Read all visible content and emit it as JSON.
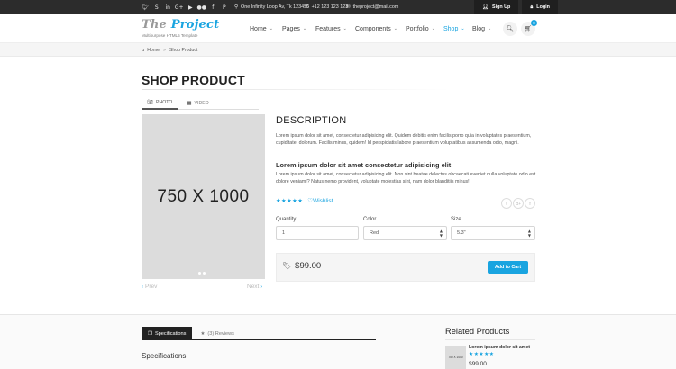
{
  "topbar": {
    "social_icons": [
      {
        "name": "twitter-icon",
        "glyph": "🐦︎"
      },
      {
        "name": "skype-icon",
        "glyph": "S"
      },
      {
        "name": "linkedin-icon",
        "glyph": "in"
      },
      {
        "name": "google-plus-icon",
        "glyph": "G+"
      },
      {
        "name": "youtube-icon",
        "glyph": "▶"
      },
      {
        "name": "flickr-icon",
        "glyph": "●●"
      },
      {
        "name": "facebook-icon",
        "glyph": "f"
      },
      {
        "name": "pinterest-icon",
        "glyph": "P"
      }
    ],
    "address": "One Infinity Loop Av, Tk 123456",
    "phone": "+12 123 123 123",
    "email": "theproject@mail.com",
    "signup_label": "Sign Up",
    "login_label": "Login"
  },
  "header": {
    "logo_the": "The",
    "logo_project": "Project",
    "tagline": "Multipurpose HTML5 Template",
    "nav": [
      {
        "label": "Home",
        "active": false
      },
      {
        "label": "Pages",
        "active": false
      },
      {
        "label": "Features",
        "active": false
      },
      {
        "label": "Components",
        "active": false
      },
      {
        "label": "Portfolio",
        "active": false
      },
      {
        "label": "Shop",
        "active": true
      },
      {
        "label": "Blog",
        "active": false
      }
    ],
    "cart_count": "0",
    "accent_color": "#19a4e0"
  },
  "breadcrumb": {
    "home": "Home",
    "current": "Shop Product"
  },
  "page": {
    "title": "SHOP PRODUCT"
  },
  "media": {
    "tab_photo": "PHOTO",
    "tab_video": "VIDEO",
    "placeholder": "750 X 1000",
    "prev": "Prev",
    "next": "Next"
  },
  "product": {
    "description_title": "DESCRIPTION",
    "para1": "Lorem ipsum dolor sit amet, consectetur adipisicing elit. Quidem debitis enim facilis porro quia in voluptates praesentium, cupiditate, dolorum. Facilis minus, quidem! Id perspiciatis labore praesentium voluptatibus assumenda odio, magni.",
    "subhead": "Lorem ipsum dolor sit amet consectetur adipisicing elit",
    "para2": "Lorem ipsum dolor sit amet, consectetur adipisicing elit. Non sint beatae delectus obcaecati eveniet nulla voluptate odio est dolore veniam!? Natus nemo provident, voluptate molestias sint, nam dolor blanditiis minus!",
    "rating": 5,
    "stars": "★★★★★",
    "wishlist_label": "Wishlist",
    "share": [
      "t",
      "G+",
      "f"
    ],
    "quantity_label": "Quantity",
    "quantity_value": "1",
    "color_label": "Color",
    "color_value": "Red",
    "size_label": "Size",
    "size_value": "5.3\"",
    "price": "$99.00",
    "add_to_cart_label": "Add to Cart"
  },
  "details": {
    "tab_specifications": "Specifications",
    "tab_reviews": "(3) Reviews",
    "section_title": "Specifications"
  },
  "related": {
    "title": "Related Products",
    "items": [
      {
        "name": "Lorem ipsum dolor sit amet",
        "thumb": "750 X 1000",
        "stars": "★★★★★",
        "price": "$99.00"
      }
    ]
  }
}
